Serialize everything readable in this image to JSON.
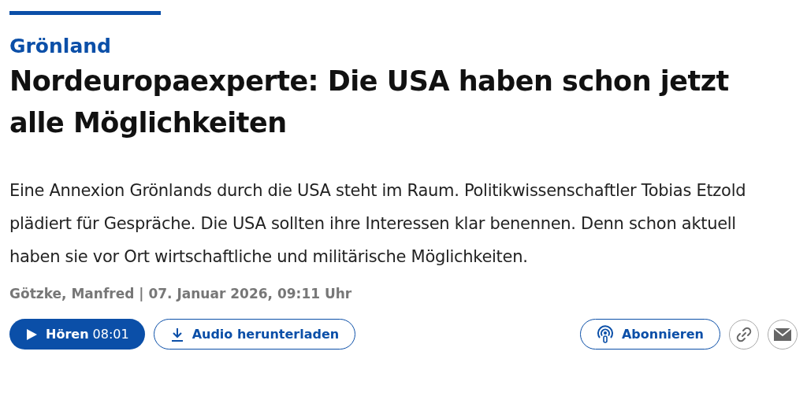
{
  "category": "Grönland",
  "headline": "Nordeuropaexperte: Die USA haben schon jetzt alle Möglichkeiten",
  "teaser": "Eine Annexion Grönlands durch die USA steht im Raum. Politikwissenschaftler Tobias Etzold plädiert für Gespräche. Die USA sollten ihre Interessen klar benennen. Denn schon aktuell haben sie vor Ort wirtschaftliche und militärische Möglichkeiten.",
  "byline": "Götzke, Manfred | 07. Januar 2026, 09:11 Uhr",
  "actions": [
    {
      "kind": "play",
      "label": "Hören",
      "duration": "08:01"
    },
    {
      "kind": "download",
      "label": "Audio herunterladen"
    }
  ],
  "share": [
    {
      "kind": "subscribe",
      "label": "Abonnieren"
    },
    {
      "kind": "link"
    },
    {
      "kind": "mail"
    }
  ]
}
